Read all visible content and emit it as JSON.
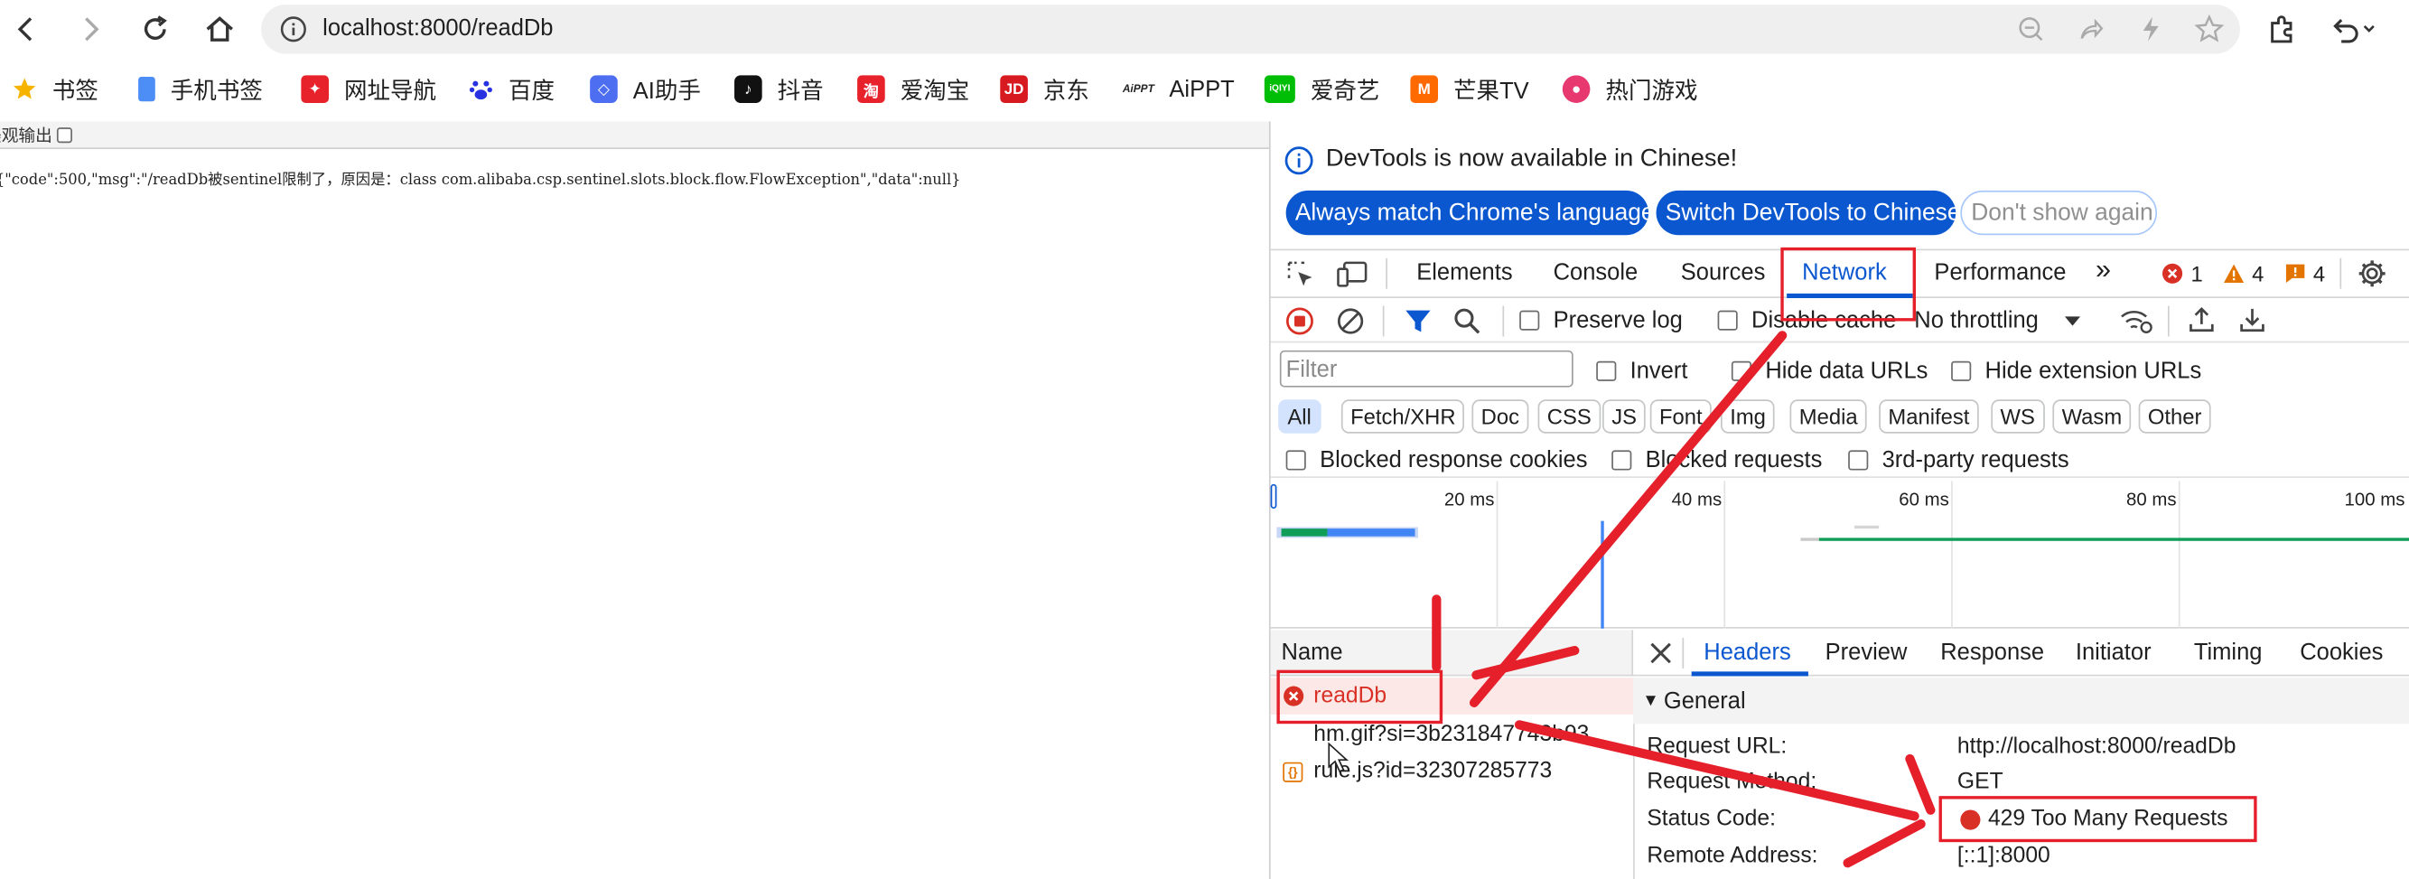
{
  "browser": {
    "url": "localhost:8000/readDb"
  },
  "bookmarks": [
    {
      "label": "书签",
      "color": "#f6b400"
    },
    {
      "label": "手机书签",
      "color": "#4d8df6"
    },
    {
      "label": "网址导航",
      "color": "#e8222b"
    },
    {
      "label": "百度",
      "color": "#2932e1"
    },
    {
      "label": "AI助手",
      "color": "#4e6ef2"
    },
    {
      "label": "抖音",
      "color": "#111111"
    },
    {
      "label": "爱淘宝",
      "color": "#e8222b"
    },
    {
      "label": "京东",
      "color": "#d71920"
    },
    {
      "label": "AiPPT",
      "color": "#222222",
      "icon_text": "AiPPT"
    },
    {
      "label": "爱奇艺",
      "color": "#00be06",
      "icon_text": "iQIYI"
    },
    {
      "label": "芒果TV",
      "color": "#ff6a00"
    },
    {
      "label": "热门游戏",
      "color": "#e83870"
    }
  ],
  "page": {
    "checkbox_label": "美观输出",
    "json_text": "{\"code\":500,\"msg\":\"/readDb被sentinel限制了，原因是：class com.alibaba.csp.sentinel.slots.block.flow.FlowException\",\"data\":null}"
  },
  "devtools": {
    "info": {
      "message": "DevTools is now available in Chinese!",
      "btn_match": "Always match Chrome's language",
      "btn_switch": "Switch DevTools to Chinese",
      "btn_dismiss": "Don't show again"
    },
    "tabs": [
      "Elements",
      "Console",
      "Sources",
      "Network",
      "Performance"
    ],
    "active_tab": "Network",
    "more": "»",
    "counts": {
      "errors": "1",
      "warnings": "4",
      "issues": "4"
    },
    "toolbar": {
      "preserve_log": "Preserve log",
      "disable_cache": "Disable cache",
      "throttling": "No throttling"
    },
    "filter": {
      "placeholder": "Filter",
      "invert": "Invert",
      "hide_data_urls": "Hide data URLs",
      "hide_extension_urls": "Hide extension URLs"
    },
    "types": [
      "All",
      "Fetch/XHR",
      "Doc",
      "CSS",
      "JS",
      "Font",
      "Img",
      "Media",
      "Manifest",
      "WS",
      "Wasm",
      "Other"
    ],
    "blocked": {
      "cookies": "Blocked response cookies",
      "requests": "Blocked requests",
      "third_party": "3rd-party requests"
    },
    "timeline_ticks": [
      "20 ms",
      "40 ms",
      "60 ms",
      "80 ms",
      "100 ms"
    ],
    "requests_header": "Name",
    "requests": [
      {
        "name": "readDb",
        "status": "error"
      },
      {
        "name": "hm.gif?si=3b231847743b93"
      },
      {
        "name": "rule.js?id=32307285773"
      }
    ],
    "detail_tabs": [
      "Headers",
      "Preview",
      "Response",
      "Initiator",
      "Timing",
      "Cookies"
    ],
    "active_detail_tab": "Headers",
    "general": {
      "title": "General",
      "rows": [
        {
          "label": "Request URL:",
          "value": "http://localhost:8000/readDb"
        },
        {
          "label": "Request Method:",
          "value": "GET"
        },
        {
          "label": "Status Code:",
          "value": "429 Too Many Requests"
        },
        {
          "label": "Remote Address:",
          "value": "[::1]:8000"
        }
      ]
    }
  },
  "colors": {
    "accent": "#0b57d0",
    "error_red": "#d93025",
    "annotation_red": "#e5202b"
  }
}
